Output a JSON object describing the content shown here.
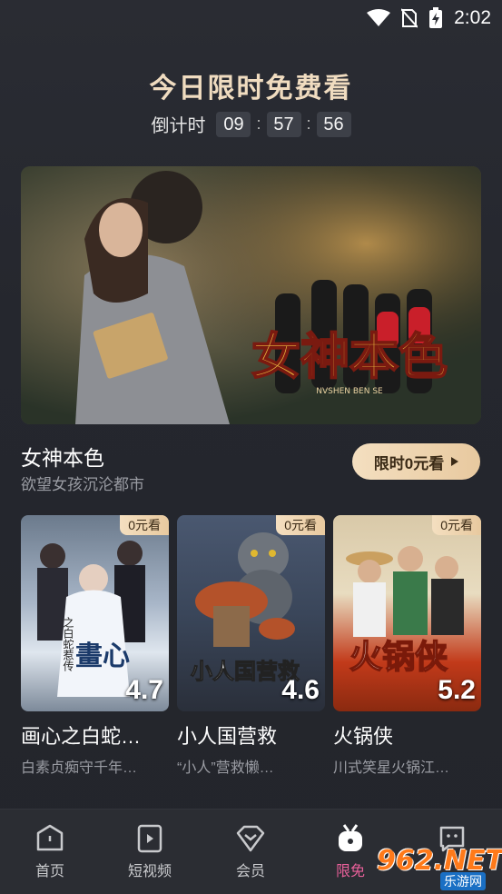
{
  "status_bar": {
    "time": "2:02",
    "icons": [
      "wifi-icon",
      "no-sim-icon",
      "battery-charging-icon"
    ]
  },
  "header": {
    "title": "今日限时免费看",
    "countdown_label": "倒计时",
    "hours": "09",
    "minutes": "57",
    "seconds": "56",
    "separator": ":"
  },
  "featured": {
    "title": "女神本色",
    "description": "欲望女孩沉沦都市",
    "button_label": "限时0元看",
    "poster_logo": "女神本色",
    "poster_caption": "NVSHEN BEN SE"
  },
  "cards": [
    {
      "title": "画心之白蛇…",
      "description": "白素贞痴守千年…",
      "badge": "0元看",
      "rating": "4.7",
      "poster_text": "畫心",
      "poster_sub": "之白蛇惹传"
    },
    {
      "title": "小人国营救",
      "description": "“小人”营救懒…",
      "badge": "0元看",
      "rating": "4.6",
      "poster_text": "小人国营救"
    },
    {
      "title": "火锅侠",
      "description": "川式笑星火锅江…",
      "badge": "0元看",
      "rating": "5.2",
      "poster_text": "火锅侠"
    }
  ],
  "nav": [
    {
      "label": "首页",
      "icon": "home-icon"
    },
    {
      "label": "短视频",
      "icon": "play-square-icon"
    },
    {
      "label": "会员",
      "icon": "diamond-icon"
    },
    {
      "label": "限免",
      "icon": "free-tv-icon",
      "active": true
    },
    {
      "label": "",
      "icon": "chat-icon"
    }
  ],
  "watermark": {
    "top": "962.NET",
    "bottom": "乐游网"
  },
  "colors": {
    "accent_gold": "#f0dcc0",
    "active_pink": "#e8609a",
    "background": "#25272e"
  }
}
